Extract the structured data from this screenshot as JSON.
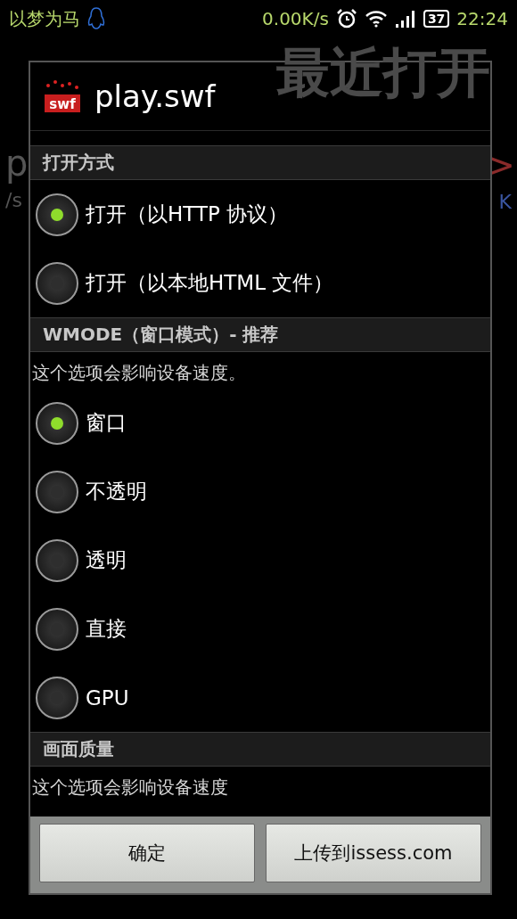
{
  "status_bar": {
    "carrier": "以梦为马",
    "speed": "0.00K/s",
    "battery": "37",
    "time": "22:24"
  },
  "background": {
    "title": "最近打开",
    "fragments": [
      {
        "text": "p",
        "kind": "plain"
      },
      {
        "text": ">",
        "kind": "tag"
      },
      {
        "text": "/s",
        "kind": "plain"
      },
      {
        "text": "K",
        "kind": "link"
      }
    ]
  },
  "dialog": {
    "icon_text": "swf",
    "title": "play.swf",
    "sections": [
      {
        "header": "打开方式",
        "options": [
          {
            "label": "打开（以HTTP 协议）",
            "selected": true
          },
          {
            "label": "打开（以本地HTML 文件）",
            "selected": false
          }
        ]
      },
      {
        "header": "WMODE（窗口模式）- 推荐",
        "note": "这个选项会影响设备速度。",
        "options": [
          {
            "label": "窗口",
            "selected": true
          },
          {
            "label": "不透明",
            "selected": false
          },
          {
            "label": "透明",
            "selected": false
          },
          {
            "label": "直接",
            "selected": false
          },
          {
            "label": "GPU",
            "selected": false
          }
        ]
      },
      {
        "header": "画面质量",
        "note": "这个选项会影响设备速度"
      }
    ],
    "buttons": [
      "确定",
      "上传到issess.com"
    ]
  }
}
